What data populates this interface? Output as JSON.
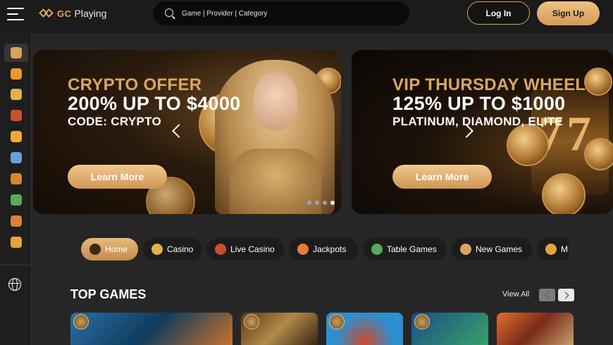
{
  "header": {
    "logo_gc": "GC",
    "logo_name": "Playing",
    "search_placeholder": "Game | Provider | Category",
    "login_label": "Log In",
    "signup_label": "Sign Up"
  },
  "sidebar": {
    "items": [
      {
        "name": "home-icon",
        "color": "#d9a35f"
      },
      {
        "name": "promotions-icon",
        "color": "#e89a2f"
      },
      {
        "name": "casino-icon",
        "color": "#e2b24a"
      },
      {
        "name": "live-casino-icon",
        "color": "#c9502f"
      },
      {
        "name": "sports-icon",
        "color": "#f0a93a"
      },
      {
        "name": "jackpots-icon",
        "color": "#6aa0d8"
      },
      {
        "name": "table-games-icon",
        "color": "#d8852f"
      },
      {
        "name": "new-games-icon",
        "color": "#5aa85a"
      },
      {
        "name": "vip-icon",
        "color": "#e07e3a"
      },
      {
        "name": "tournament-icon",
        "color": "#e2a53d"
      }
    ],
    "language_icon": "globe-icon"
  },
  "banners": [
    {
      "line1": "CRYPTO OFFER",
      "line2": "200% UP TO $4000",
      "line3": "CODE: CRYPTO",
      "button": "Learn More"
    },
    {
      "line1": "VIP THURSDAY WHEEL",
      "line2": "125% UP TO $1000",
      "line3": "PLATINUM, DIAMOND, ELITE",
      "button": "Learn More"
    }
  ],
  "carousel": {
    "slide_count": 4,
    "active_index": 3
  },
  "categories": [
    {
      "label": "Home",
      "icon": "home-icon",
      "active": true
    },
    {
      "label": "Casino",
      "icon": "slot-777-icon",
      "active": false
    },
    {
      "label": "Live Casino",
      "icon": "roulette-icon",
      "active": false
    },
    {
      "label": "Jackpots",
      "icon": "crown-icon",
      "active": false
    },
    {
      "label": "Table Games",
      "icon": "cards-icon",
      "active": false
    },
    {
      "label": "New Games",
      "icon": "new-icon",
      "active": false
    },
    {
      "label": "M",
      "icon": "more-icon",
      "active": false
    }
  ],
  "top_games": {
    "title": "TOP GAMES",
    "view_all": "View All"
  },
  "colors": {
    "accent": "#d9a35f",
    "background": "#262626",
    "header": "#1b1b1b"
  }
}
